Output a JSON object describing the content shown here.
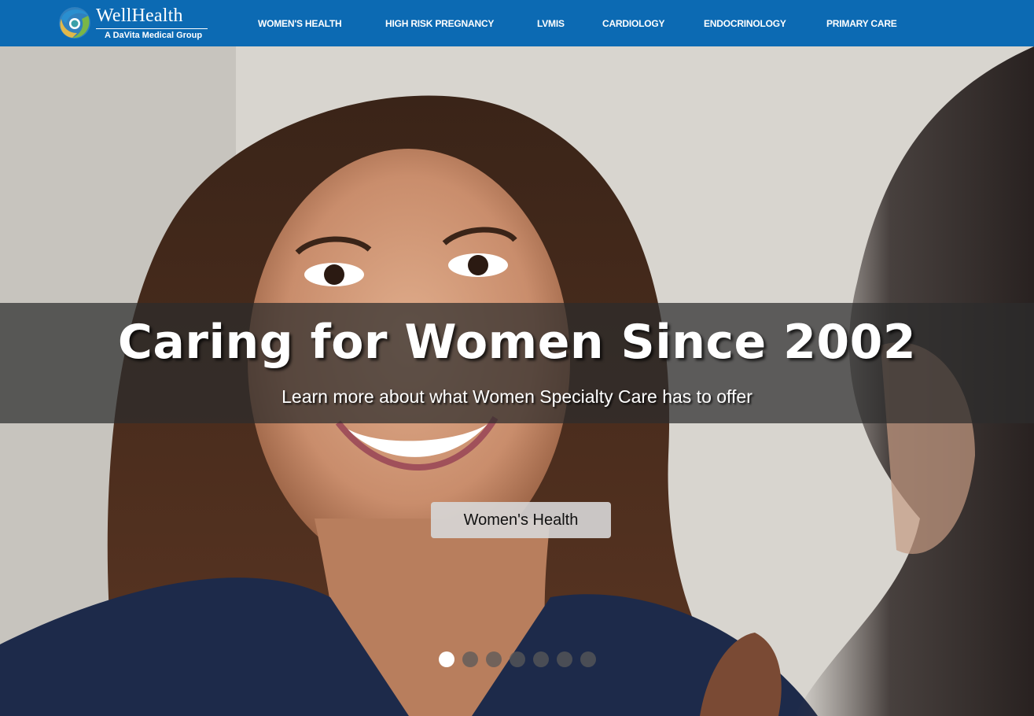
{
  "brand": {
    "name": "WellHealth",
    "tagline": "A DaVita Medical Group",
    "colors": {
      "nav_background": "#0c6ab3",
      "logo_green": "#7ab648",
      "logo_blue": "#2a8fd0",
      "logo_gold": "#e0b84a"
    }
  },
  "nav": {
    "items": [
      {
        "label": "WOMEN'S HEALTH"
      },
      {
        "label": "HIGH RISK PREGNANCY"
      },
      {
        "label": "LVMIS"
      },
      {
        "label": "CARDIOLOGY"
      },
      {
        "label": "ENDOCRINOLOGY"
      },
      {
        "label": "PRIMARY CARE"
      }
    ]
  },
  "hero": {
    "title": "Caring for Women Since 2002",
    "subtitle": "Learn more about what Women Specialty Care has to offer",
    "button_label": "Women's Health",
    "slide_count": 7,
    "active_slide": 1
  }
}
